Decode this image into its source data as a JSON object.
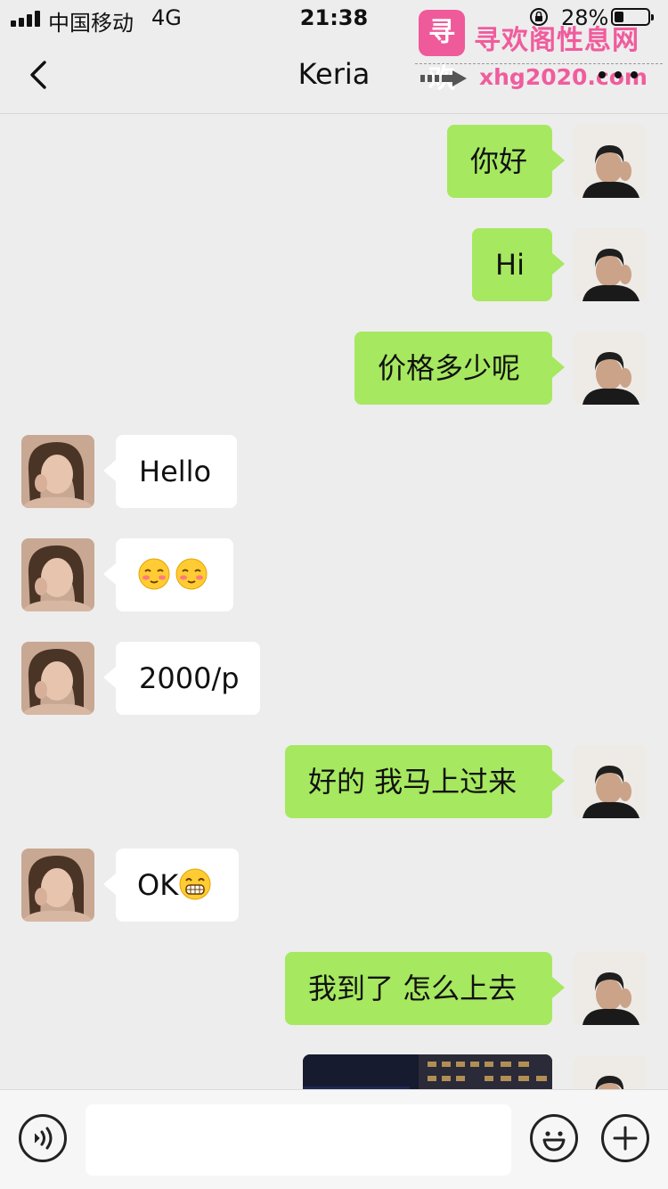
{
  "status_bar": {
    "carrier": "中国移动",
    "network": "4G",
    "time": "21:38",
    "battery_percent": "28%",
    "battery_level": 0.28
  },
  "watermark": {
    "logo_text": "寻欢",
    "title": "寻欢阁性息网",
    "url": "xhg2020.com"
  },
  "nav": {
    "title": "Keria"
  },
  "messages": [
    {
      "sender": "me",
      "text": "你好"
    },
    {
      "sender": "me",
      "text": "Hi"
    },
    {
      "sender": "me",
      "text": "价格多少呢"
    },
    {
      "sender": "them",
      "text": "Hello"
    },
    {
      "sender": "them",
      "text": "",
      "emoji": [
        "blushing-face",
        "blushing-face"
      ]
    },
    {
      "sender": "them",
      "text": "2000/p"
    },
    {
      "sender": "me",
      "text": "好的 我马上过来"
    },
    {
      "sender": "them",
      "text": "OK",
      "emoji": [
        "grinning-face"
      ]
    },
    {
      "sender": "me",
      "text": "我到了 怎么上去"
    },
    {
      "sender": "me",
      "type": "image"
    }
  ],
  "input": {
    "placeholder": "",
    "value": ""
  },
  "colors": {
    "background": "#ededed",
    "my_bubble": "#a6e860",
    "their_bubble": "#ffffff",
    "watermark_pink": "#f05c9d"
  }
}
